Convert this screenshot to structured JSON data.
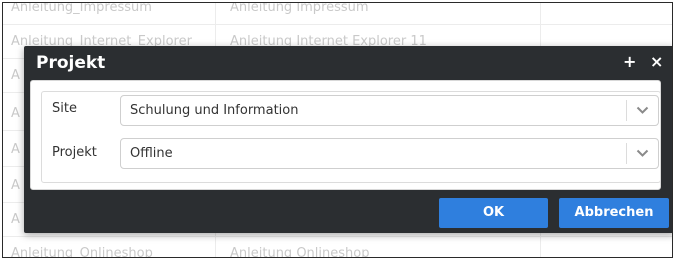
{
  "background_table": {
    "rows": [
      {
        "col1": "Anleitung_Impressum",
        "col2": "Anleitung Impressum"
      },
      {
        "col1": "Anleitung_Internet_Explorer",
        "col2": "Anleitung Internet Explorer 11"
      },
      {
        "col1": "A",
        "col2": ""
      },
      {
        "col1": "A",
        "col2": ""
      },
      {
        "col1": "A",
        "col2": ""
      },
      {
        "col1": "A",
        "col2": ""
      },
      {
        "col1": "A",
        "col2": ""
      },
      {
        "col1": "Anleitung_Onlineshop",
        "col2": "Anleitung Onlineshop"
      }
    ]
  },
  "dialog": {
    "title": "Projekt",
    "plus_label": "+",
    "close_label": "×",
    "fields": {
      "site": {
        "label": "Site",
        "value": "Schulung und Information"
      },
      "projekt": {
        "label": "Projekt",
        "value": "Offline"
      }
    },
    "ok_label": "OK",
    "cancel_label": "Abbrechen"
  },
  "colors": {
    "dialog_bg": "#2b2e31",
    "button_primary": "#2f7fde"
  }
}
